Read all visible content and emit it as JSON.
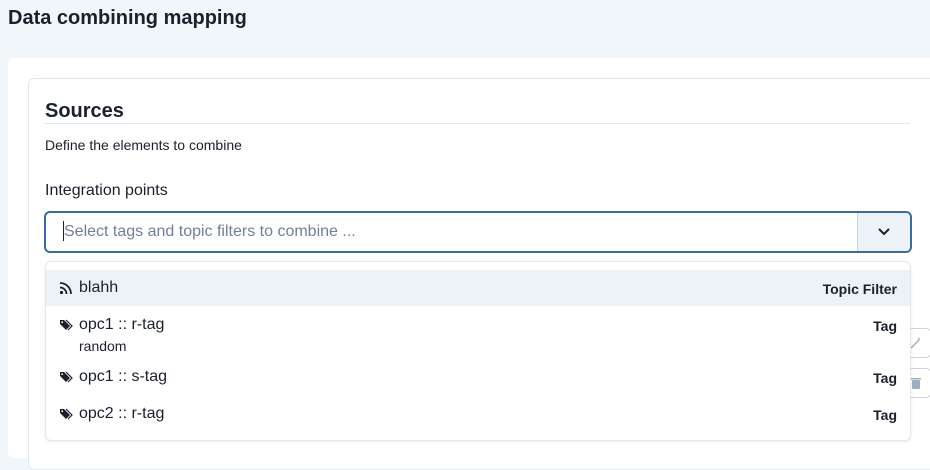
{
  "page": {
    "title": "Data combining mapping"
  },
  "sources": {
    "title": "Sources",
    "description": "Define the elements to combine",
    "integration_label": "Integration points",
    "select": {
      "placeholder": "Select tags and topic filters to combine ..."
    },
    "options": [
      {
        "label": "blahh",
        "sublabel": "",
        "type": "Topic Filter",
        "icon": "rss-icon"
      },
      {
        "label": "opc1 :: r-tag",
        "sublabel": "random",
        "type": "Tag",
        "icon": "tag-icon"
      },
      {
        "label": "opc1 :: s-tag",
        "sublabel": "",
        "type": "Tag",
        "icon": "tag-icon"
      },
      {
        "label": "opc2 :: r-tag",
        "sublabel": "",
        "type": "Tag",
        "icon": "tag-icon"
      }
    ]
  },
  "colors": {
    "focus_border": "#3c6a9e",
    "page_bg": "#f1f6fa",
    "highlight_bg": "#edf2f7"
  }
}
